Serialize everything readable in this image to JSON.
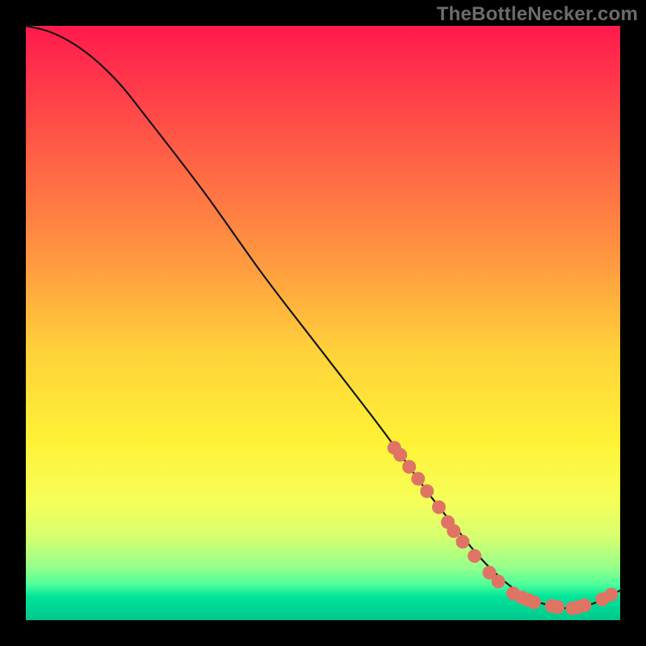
{
  "watermark": "TheBottleNecker.com",
  "colors": {
    "page_bg": "#000000",
    "curve": "#161616",
    "dot": "#e07464",
    "watermark": "#6c6c6c"
  },
  "chart_data": {
    "type": "line",
    "title": "",
    "xlabel": "",
    "ylabel": "",
    "xlim": [
      0,
      100
    ],
    "ylim": [
      0,
      100
    ],
    "curve": {
      "x": [
        0,
        4,
        8,
        12,
        16,
        20,
        30,
        40,
        50,
        60,
        68,
        72,
        76,
        80,
        84,
        88,
        92,
        96,
        100
      ],
      "y": [
        100,
        99,
        97,
        94,
        90,
        85,
        72,
        58,
        45,
        32,
        21,
        16,
        11,
        7,
        4,
        2.5,
        2,
        3,
        5
      ]
    },
    "series": [
      {
        "name": "markers",
        "x": [
          62,
          63,
          64.5,
          66,
          67.5,
          69.5,
          71,
          72,
          73.5,
          75.5,
          78,
          79.5,
          82,
          83.5,
          84.5,
          85.5,
          88.5,
          89.5,
          92,
          93,
          94,
          97,
          98.5
        ],
        "y": [
          29,
          27.8,
          25.8,
          23.8,
          21.7,
          19,
          16.5,
          15,
          13.2,
          10.8,
          8,
          6.5,
          4.5,
          3.8,
          3.4,
          3,
          2.4,
          2.2,
          2,
          2.2,
          2.5,
          3.5,
          4.3
        ]
      }
    ]
  }
}
